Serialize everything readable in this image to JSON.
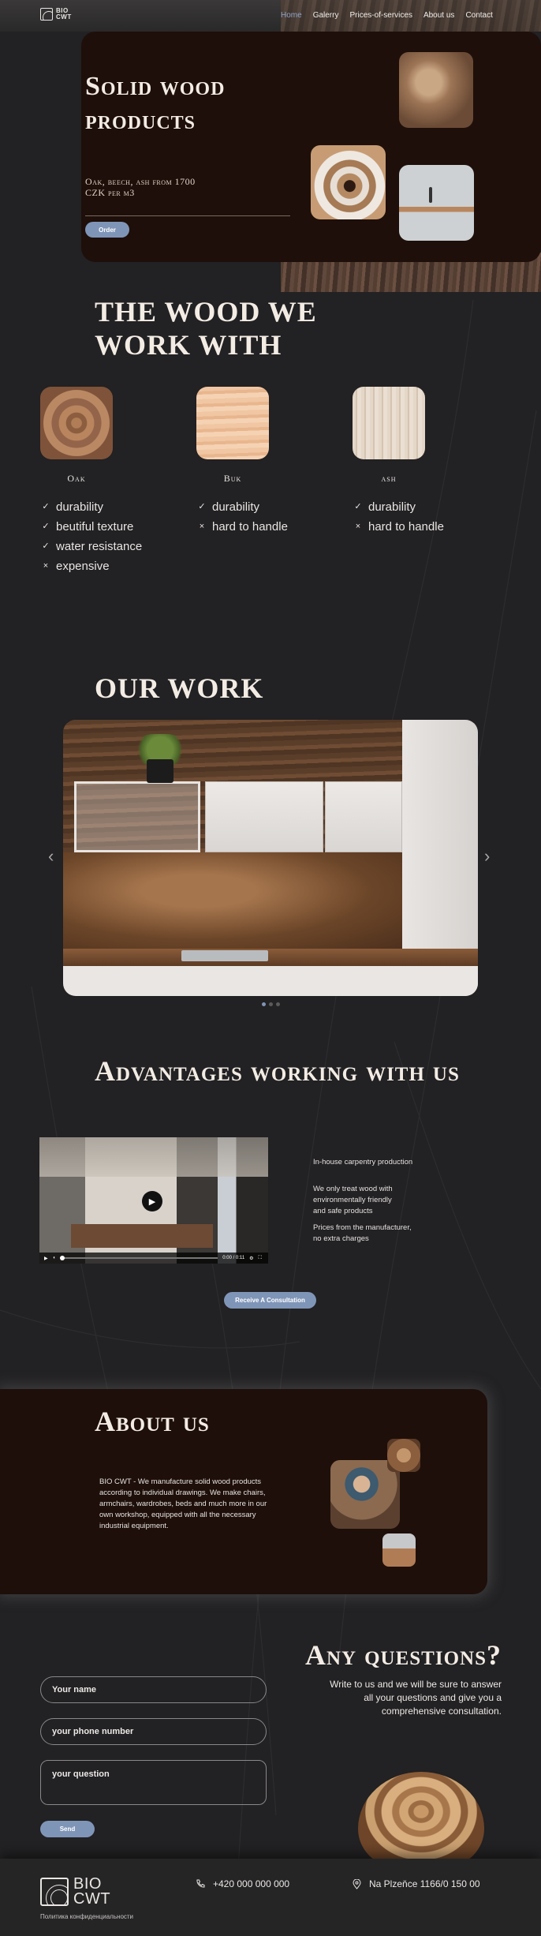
{
  "header": {
    "logo_text_line1": "BIO",
    "logo_text_line2": "CWT",
    "nav": [
      "Home",
      "Galerry",
      "Prices-of-services",
      "About us",
      "Contact"
    ],
    "active_nav": "Home"
  },
  "hero": {
    "title": "Solid wood products",
    "subtitle_line1": "Oak, beech, ash from 1700",
    "subtitle_line2": "CZK per m3",
    "order_label": "Order"
  },
  "wood": {
    "heading": "THE WOOD WE WORK WITH",
    "types": [
      {
        "name": "Oak",
        "features": [
          {
            "mark": "✓",
            "text": "durability"
          },
          {
            "mark": "✓",
            "text": "beutiful texture"
          },
          {
            "mark": "✓",
            "text": "water resistance"
          },
          {
            "mark": "×",
            "text": "expensive"
          }
        ]
      },
      {
        "name": "Buk",
        "features": [
          {
            "mark": "✓",
            "text": "durability"
          },
          {
            "mark": "×",
            "text": "hard to handle"
          }
        ]
      },
      {
        "name": "ash",
        "features": [
          {
            "mark": "✓",
            "text": "durability"
          },
          {
            "mark": "×",
            "text": "hard to handle"
          }
        ]
      }
    ]
  },
  "work": {
    "heading": "OUR WORK",
    "prev_arrow": "‹",
    "next_arrow": "›"
  },
  "advantages": {
    "heading": "Advantages working with us",
    "video_time": "0:00 / 0:11",
    "points": [
      "In-house carpentry production",
      "We only treat wood with environmentally friendly and safe products",
      "Prices from the manufacturer, no extra charges"
    ],
    "cta_label": "Receive A Consultation"
  },
  "about": {
    "heading": "About us",
    "text": "BIO CWT - We manufacture solid wood products according to individual drawings. We make chairs, armchairs, wardrobes, beds and much more in our own workshop, equipped with all the necessary industrial equipment."
  },
  "questions": {
    "heading": "Any questions?",
    "subtitle": "Write to us and we will be sure to answer all your questions and give you a comprehensive consultation.",
    "name_placeholder": "Your name",
    "phone_placeholder": "your phone number",
    "question_placeholder": "your question",
    "send_label": "Send"
  },
  "footer": {
    "logo_line1": "BIO",
    "logo_line2": "CWT",
    "policy": "Политика конфиденциальности",
    "phone": "+420 000 000 000",
    "address": "Na Plzeňce 1166/0 150 00"
  },
  "colors": {
    "background": "#222123",
    "panel": "#1e0f0a",
    "accent": "#7f95b8",
    "nav_active": "#8ea4c7"
  }
}
